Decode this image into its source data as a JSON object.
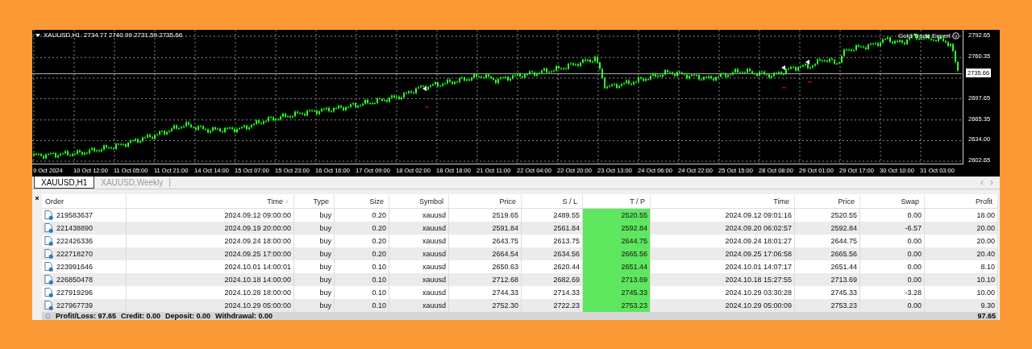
{
  "chart": {
    "symbol": "XAUUSD,H1",
    "ohlc": "2734.77 2740.99 2731.59 2735.66",
    "expert": "Gold Trade Expert",
    "current_price": "2735.66",
    "price_ticks": [
      "2792.65",
      "2760.35",
      "2697.65",
      "2665.35",
      "2634.00",
      "2602.65"
    ],
    "time_labels": [
      "9 Oct 2024",
      "10 Oct 12:00",
      "11 Oct 05:00",
      "11 Oct 21:00",
      "14 Oct 14:00",
      "15 Oct 07:00",
      "15 Oct 23:00",
      "16 Oct 16:00",
      "17 Oct 09:00",
      "18 Oct 02:00",
      "18 Oct 18:00",
      "21 Oct 11:00",
      "22 Oct 04:00",
      "22 Oct 20:00",
      "23 Oct 13:00",
      "24 Oct 06:00",
      "24 Oct 22:00",
      "25 Oct 15:00",
      "28 Oct 08:00",
      "29 Oct 01:00",
      "29 Oct 17:00",
      "30 Oct 10:00",
      "31 Oct 03:00"
    ]
  },
  "tabs": [
    {
      "label": "XAUUSD,H1",
      "selected": true
    },
    {
      "label": "XAUUSD,Weekly",
      "selected": false
    }
  ],
  "table": {
    "columns": [
      {
        "label": "Order",
        "sorted": false,
        "highlighted": false
      },
      {
        "label": "Time",
        "sorted": true,
        "highlighted": false
      },
      {
        "label": "Type",
        "sorted": false,
        "highlighted": false
      },
      {
        "label": "Size",
        "sorted": false,
        "highlighted": false
      },
      {
        "label": "Symbol",
        "sorted": false,
        "highlighted": false
      },
      {
        "label": "Price",
        "sorted": false,
        "highlighted": false
      },
      {
        "label": "S / L",
        "sorted": false,
        "highlighted": false
      },
      {
        "label": "T / P",
        "sorted": false,
        "highlighted": true
      },
      {
        "label": "Time",
        "sorted": false,
        "highlighted": false
      },
      {
        "label": "Price",
        "sorted": false,
        "highlighted": false
      },
      {
        "label": "Swap",
        "sorted": false,
        "highlighted": false
      },
      {
        "label": "Profit",
        "sorted": false,
        "highlighted": false
      }
    ],
    "rows": [
      [
        "219583637",
        "2024.09.12 09:00:00",
        "buy",
        "0.20",
        "xauusd",
        "2519.65",
        "2489.55",
        "2520.55",
        "2024.09.12 09:01:16",
        "2520.55",
        "0.00",
        "18.00"
      ],
      [
        "221438890",
        "2024.09.19 20:00:00",
        "buy",
        "0.20",
        "xauusd",
        "2591.84",
        "2561.84",
        "2592.84",
        "2024.09.20 06:02:57",
        "2592.84",
        "-6.57",
        "20.00"
      ],
      [
        "222426336",
        "2024.09.24 18:00:00",
        "buy",
        "0.20",
        "xauusd",
        "2643.75",
        "2613.75",
        "2644.75",
        "2024.09.24 18:01:27",
        "2644.75",
        "0.00",
        "20.00"
      ],
      [
        "222718270",
        "2024.09.25 17:00:00",
        "buy",
        "0.20",
        "xauusd",
        "2664.54",
        "2634.56",
        "2665.56",
        "2024.09.25 17:06:58",
        "2665.56",
        "0.00",
        "20.40"
      ],
      [
        "223991646",
        "2024.10.01 14:00:01",
        "buy",
        "0.10",
        "xauusd",
        "2650.63",
        "2620.44",
        "2651.44",
        "2024.10.01 14:07:17",
        "2651.44",
        "0.00",
        "8.10"
      ],
      [
        "226850478",
        "2024.10.18 14:00:00",
        "buy",
        "0.10",
        "xauusd",
        "2712.68",
        "2682.69",
        "2713.69",
        "2024.10.18 15:27:55",
        "2713.69",
        "0.00",
        "10.10"
      ],
      [
        "227919296",
        "2024.10.28 18:00:00",
        "buy",
        "0.10",
        "xauusd",
        "2744.33",
        "2714.33",
        "2745.33",
        "2024.10.29 03:30:28",
        "2745.33",
        "-3.28",
        "10.00"
      ],
      [
        "227967739",
        "2024.10.29 05:00:00",
        "buy",
        "0.10",
        "xauusd",
        "2752.30",
        "2722.23",
        "2753.23",
        "2024.10.29 05:00:09",
        "2753.23",
        "0.00",
        "9.30"
      ]
    ]
  },
  "footer": {
    "items": [
      "Profit/Loss: 97.65",
      "Credit: 0.00",
      "Deposit: 0.00",
      "Withdrawal: 0.00"
    ],
    "total": "97.65"
  }
}
